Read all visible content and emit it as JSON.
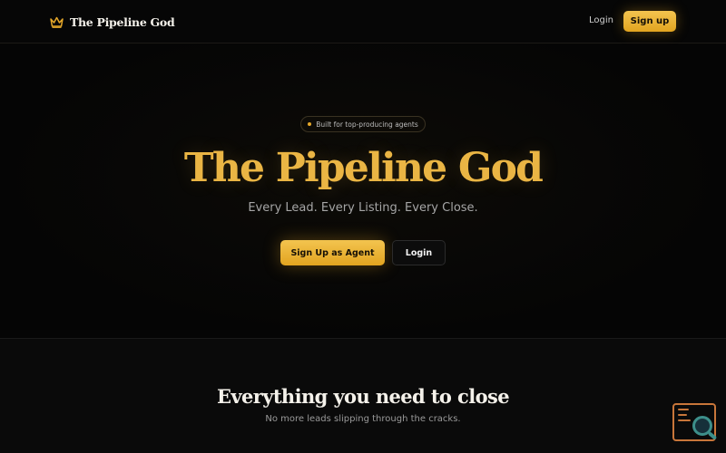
{
  "nav": {
    "brand_name": "The Pipeline God",
    "login_label": "Login",
    "signup_label": "Sign up"
  },
  "hero": {
    "badge_text": "Built for top-producing agents",
    "title": "The Pipeline God",
    "subtitle": "Every Lead. Every Listing. Every Close.",
    "primary_cta": "Sign Up as Agent",
    "secondary_cta": "Login"
  },
  "features": {
    "title": "Everything you need to close",
    "subtitle": "No more leads slipping through the cracks."
  },
  "theme": {
    "accent": "#eab544",
    "button_gradient_top": "#f3c44f",
    "button_gradient_bottom": "#e2a420",
    "background": "#050505"
  },
  "icons": {
    "brand": "crown-icon",
    "badge": "dot-icon",
    "floating_widget": "feedback-widget-icon"
  }
}
